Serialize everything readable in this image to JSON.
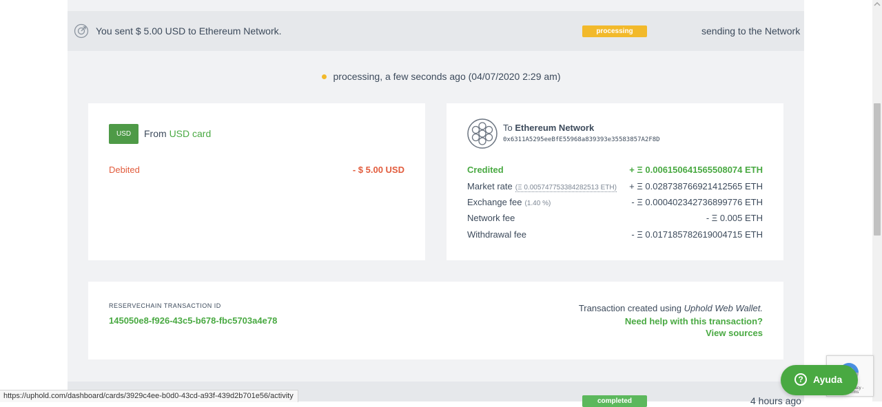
{
  "transaction": {
    "header_title": "You sent $ 5.00 USD to Ethereum Network.",
    "status_badge": "processing",
    "header_status": "sending to the Network",
    "status_line": "processing, a few seconds ago (04/07/2020 2:29 am)"
  },
  "from_card": {
    "chip": "USD",
    "from_prefix": "From",
    "from_name": "USD card",
    "debited_label": "Debited",
    "debited_value": "- $ 5.00 USD"
  },
  "to_card": {
    "to_prefix": "To",
    "to_name": "Ethereum Network",
    "address": "0x6311A5295eeBfE55968a839393e35583857A2F8D",
    "rows": [
      {
        "label": "Credited",
        "note": "",
        "value": "+ Ξ 0.006150641565508074 ETH"
      },
      {
        "label": "Market rate",
        "note": "(Ξ 0.005747753384282513 ETH)",
        "value": "+ Ξ 0.028738766921412565 ETH"
      },
      {
        "label": "Exchange fee",
        "note": "(1.40 %)",
        "value": "- Ξ 0.000402342736899776 ETH"
      },
      {
        "label": "Network fee",
        "note": "",
        "value": "- Ξ 0.005 ETH"
      },
      {
        "label": "Withdrawal fee",
        "note": "",
        "value": "- Ξ 0.017185782619004715 ETH"
      }
    ]
  },
  "details": {
    "id_label": "RESERVECHAIN TRANSACTION ID",
    "id_value": "145050e8-f926-43c5-b678-fbc5703a4e78",
    "created_prefix": "Transaction created using",
    "created_app": "Uphold Web Wallet.",
    "help_link": "Need help with this transaction?",
    "sources_link": "View sources"
  },
  "next_transaction": {
    "status_badge": "completed",
    "time": "4 hours ago"
  },
  "help_button": {
    "label": "Ayuda",
    "icon": "question-icon"
  },
  "recaptcha": {
    "text": "Privacy - Terms"
  },
  "status_bar_url": "https://uphold.com/dashboard/cards/3929c4ee-b0d0-43cd-a93f-439d2b701e56/activity",
  "colors": {
    "green": "#49a942",
    "processing": "#f2b92b",
    "debit_red": "#e25c3d",
    "header_bg": "#e6e8eb"
  }
}
